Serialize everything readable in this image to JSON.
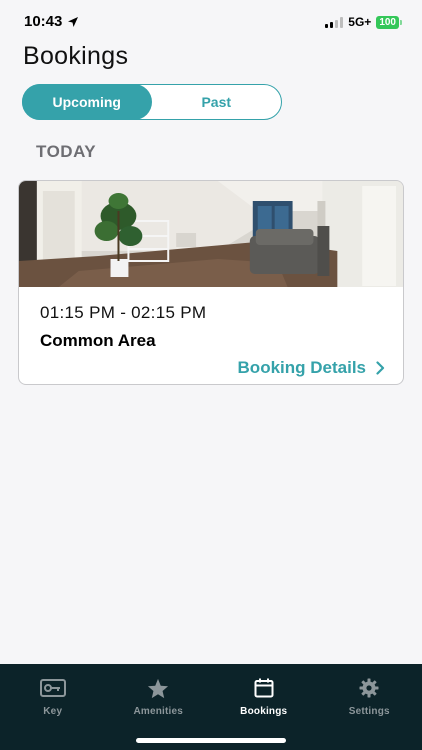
{
  "status_bar": {
    "time": "10:43",
    "network": "5G+",
    "battery": "100",
    "icons": [
      "location-arrow-icon",
      "signal-icon",
      "battery-icon"
    ]
  },
  "page": {
    "title": "Bookings"
  },
  "segments": {
    "upcoming": "Upcoming",
    "past": "Past",
    "selected": "Upcoming"
  },
  "section": {
    "label": "TODAY"
  },
  "booking": {
    "time_range": "01:15 PM - 02:15 PM",
    "location": "Common Area",
    "details_label": "Booking Details"
  },
  "tab_bar": {
    "tabs": [
      {
        "label": "Key",
        "icon": "key-card-icon"
      },
      {
        "label": "Amenities",
        "icon": "star-icon"
      },
      {
        "label": "Bookings",
        "icon": "calendar-icon"
      },
      {
        "label": "Settings",
        "icon": "gear-icon"
      }
    ],
    "active": "Bookings"
  },
  "colors": {
    "accent": "#35a2aa",
    "tab_bar_bg": "#0c2329",
    "background": "#f6f6f8",
    "battery": "#34c759"
  }
}
